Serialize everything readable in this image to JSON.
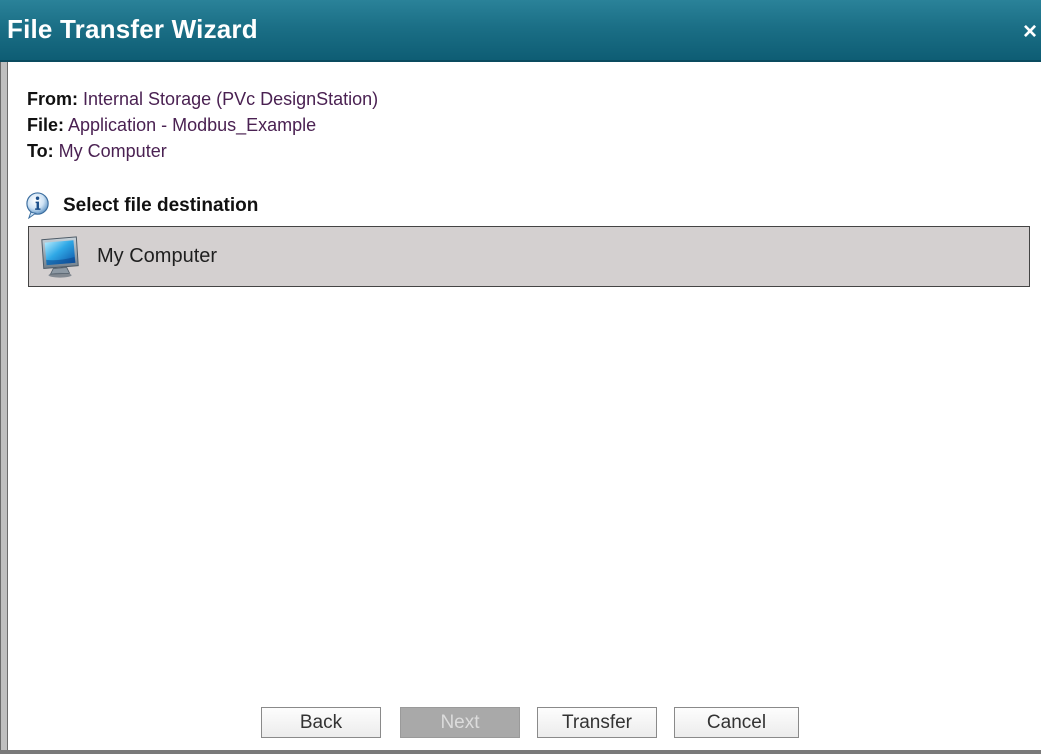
{
  "window": {
    "title": "File Transfer Wizard",
    "close_label": "×"
  },
  "info": {
    "from_label": "From:",
    "from_value": "Internal Storage (PVc DesignStation)",
    "file_label": "File:",
    "file_value": "Application - Modbus_Example",
    "to_label": "To:",
    "to_value": "My Computer"
  },
  "destination": {
    "heading": "Select file destination",
    "heading_icon": "info-icon",
    "items": [
      {
        "label": "My Computer",
        "icon": "monitor-icon",
        "selected": true
      }
    ]
  },
  "buttons": {
    "back": "Back",
    "next": "Next",
    "next_disabled": true,
    "transfer": "Transfer",
    "cancel": "Cancel"
  },
  "colors": {
    "titlebar": "#1b6f86",
    "value_text": "#4a2152",
    "selected_row": "#d4d0d0",
    "disabled_button": "#a9a9a9"
  }
}
